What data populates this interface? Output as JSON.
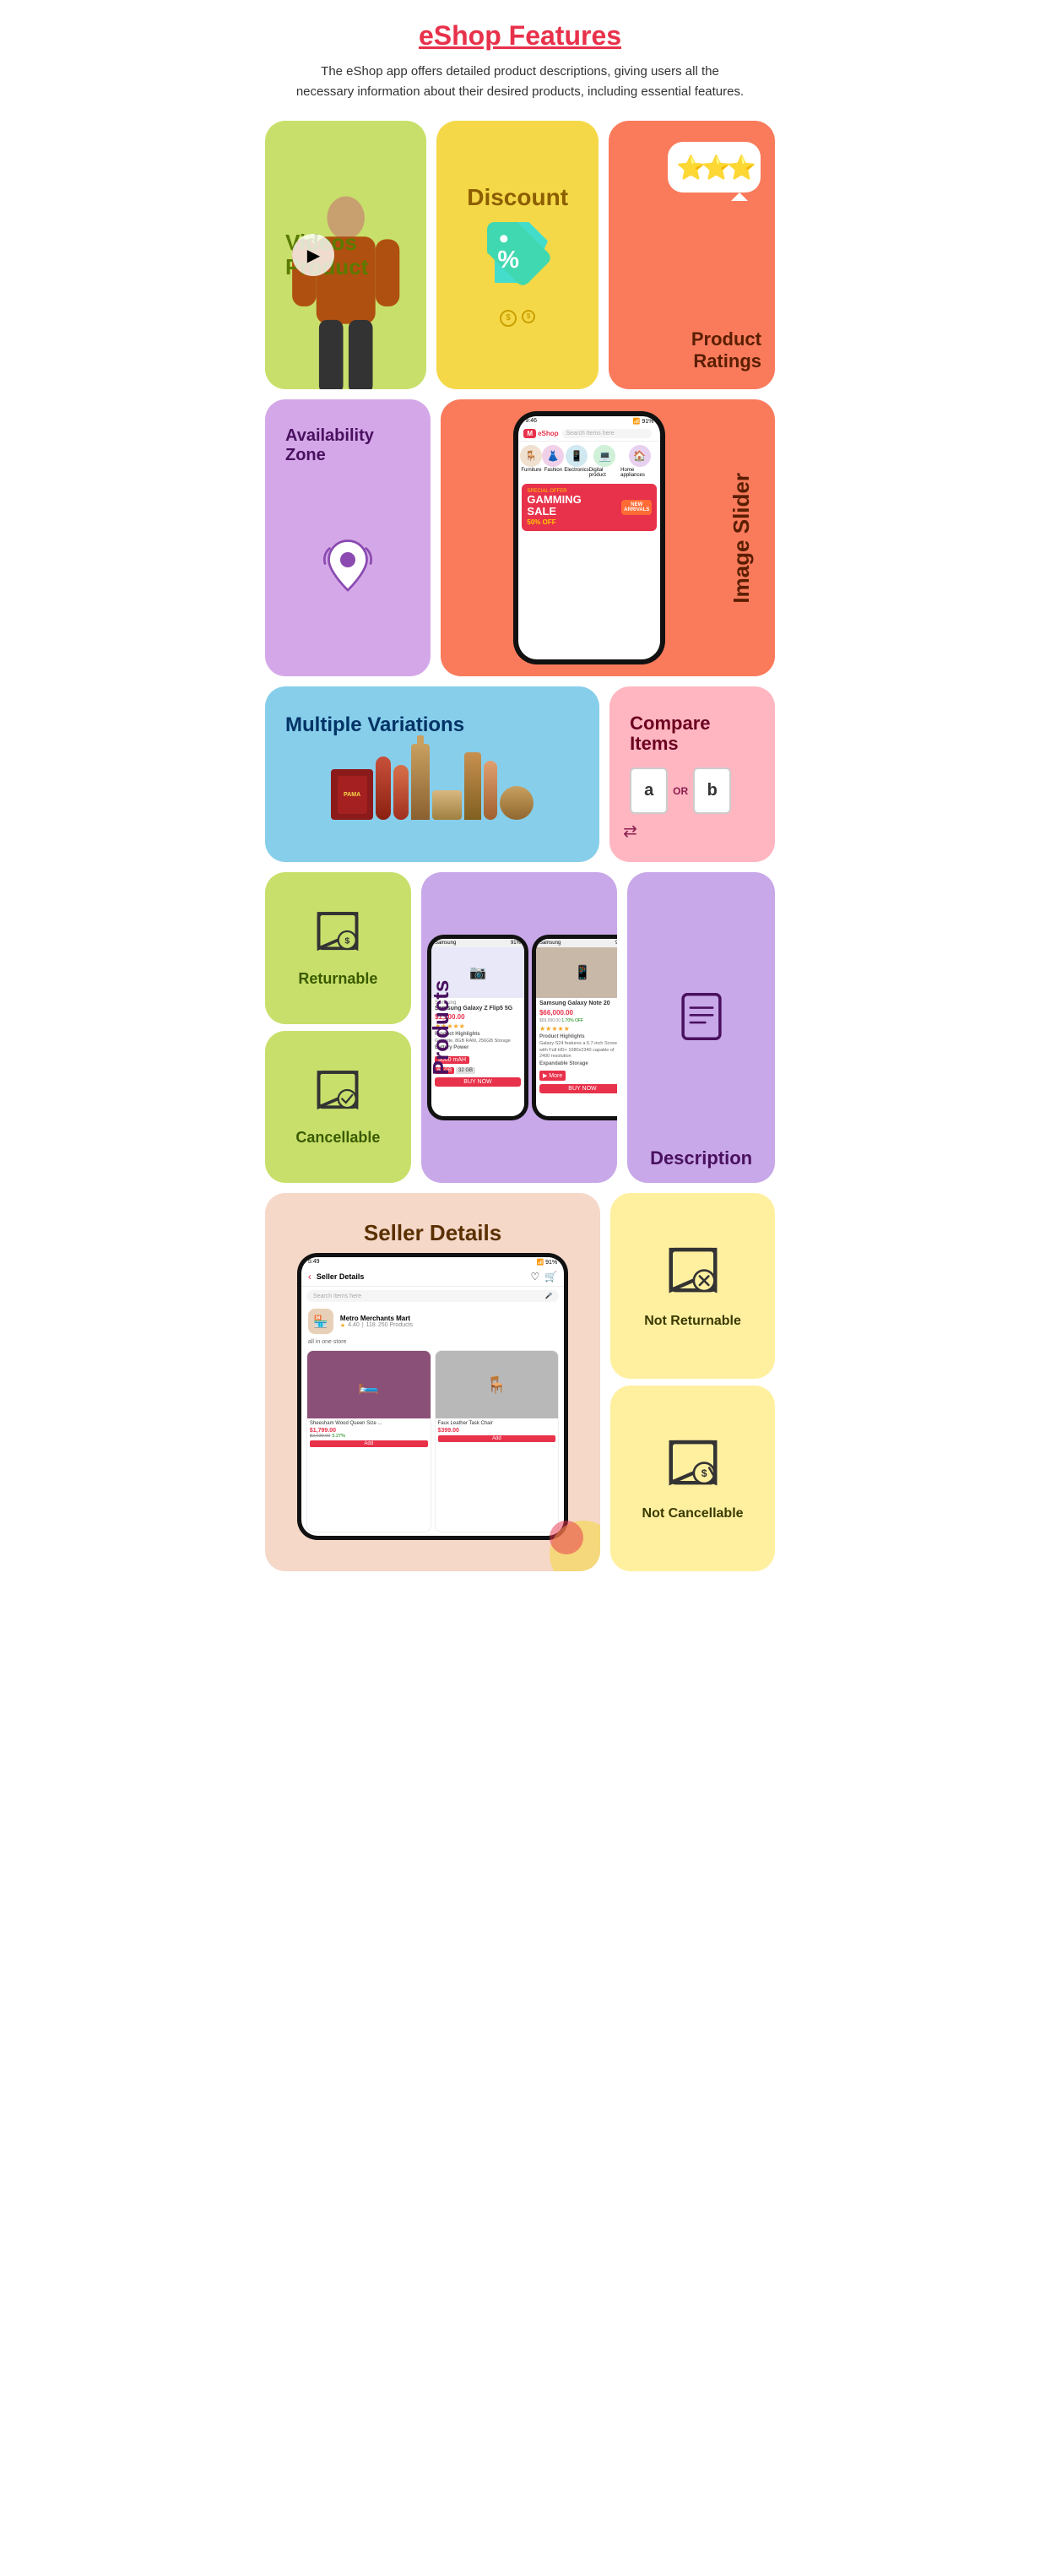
{
  "header": {
    "title": "eShop Features",
    "description": "The eShop app offers detailed product descriptions, giving users all the necessary information about their desired products, including essential features."
  },
  "cards": {
    "videos": {
      "title": "Videos Product"
    },
    "discount": {
      "title": "Discount"
    },
    "ratings": {
      "title": "Product Ratings"
    },
    "availability": {
      "title": "Availability Zone"
    },
    "imageSlider": {
      "title": "Image Slider"
    },
    "variations": {
      "title": "Multiple Variations"
    },
    "compare": {
      "title": "Compare Items"
    },
    "returnable": {
      "title": "Returnable"
    },
    "cancellable": {
      "title": "Cancellable"
    },
    "products": {
      "title": "Products"
    },
    "description": {
      "title": "Description"
    },
    "seller": {
      "title": "Seller Details"
    },
    "notReturnable": {
      "title": "Not Returnable"
    },
    "notCancellable": {
      "title": "Not Cancellable"
    }
  },
  "eshop": {
    "logo": "M eShop",
    "searchPlaceholder": "Search Items here",
    "categories": [
      {
        "name": "Furniture",
        "icon": "🪑"
      },
      {
        "name": "Fashion",
        "icon": "👗"
      },
      {
        "name": "Electronics",
        "icon": "📱"
      },
      {
        "name": "Digital product",
        "icon": "💻"
      },
      {
        "name": "Home appliances",
        "icon": "🏠"
      }
    ],
    "banner": {
      "label": "SPECIAL OFFER",
      "title": "GAMMING SALE",
      "discount": "50% OFF",
      "badge": "NEW ARRIVALS"
    }
  },
  "sellerDetails": {
    "storeName": "Metro Merchants Mart",
    "rating": "4.40",
    "reviews": "118",
    "products": "250 Products",
    "product1": {
      "name": "Sheesham Wood Queen Size ...",
      "price": "$1,799.00",
      "originalPrice": "$2,039.00",
      "discount": "5.27%"
    },
    "product2": {
      "name": "Faux Leather Task Chair",
      "price": "$399.00"
    }
  }
}
